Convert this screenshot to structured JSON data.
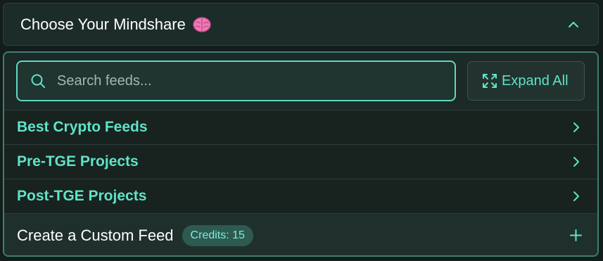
{
  "header": {
    "title": "Choose Your Mindshare",
    "emoji_icon": "brain-icon",
    "toggle_icon": "chevron-up-icon"
  },
  "search": {
    "placeholder": "Search feeds...",
    "value": "",
    "icon": "search-icon"
  },
  "expand_button": {
    "label": "Expand All",
    "icon": "expand-arrows-icon"
  },
  "feeds": [
    {
      "label": "Best Crypto Feeds",
      "icon": "chevron-right-icon"
    },
    {
      "label": "Pre-TGE Projects",
      "icon": "chevron-right-icon"
    },
    {
      "label": "Post-TGE Projects",
      "icon": "chevron-right-icon"
    }
  ],
  "custom_feed": {
    "label": "Create a Custom Feed",
    "credits_badge": "Credits: 15",
    "icon": "plus-icon"
  },
  "colors": {
    "accent": "#5fe3c8",
    "accent_border": "#5fd8c1",
    "panel_border": "#3e7e72",
    "background": "#131d1b",
    "panel_background": "#18221f",
    "badge_background": "#2d5a51"
  }
}
